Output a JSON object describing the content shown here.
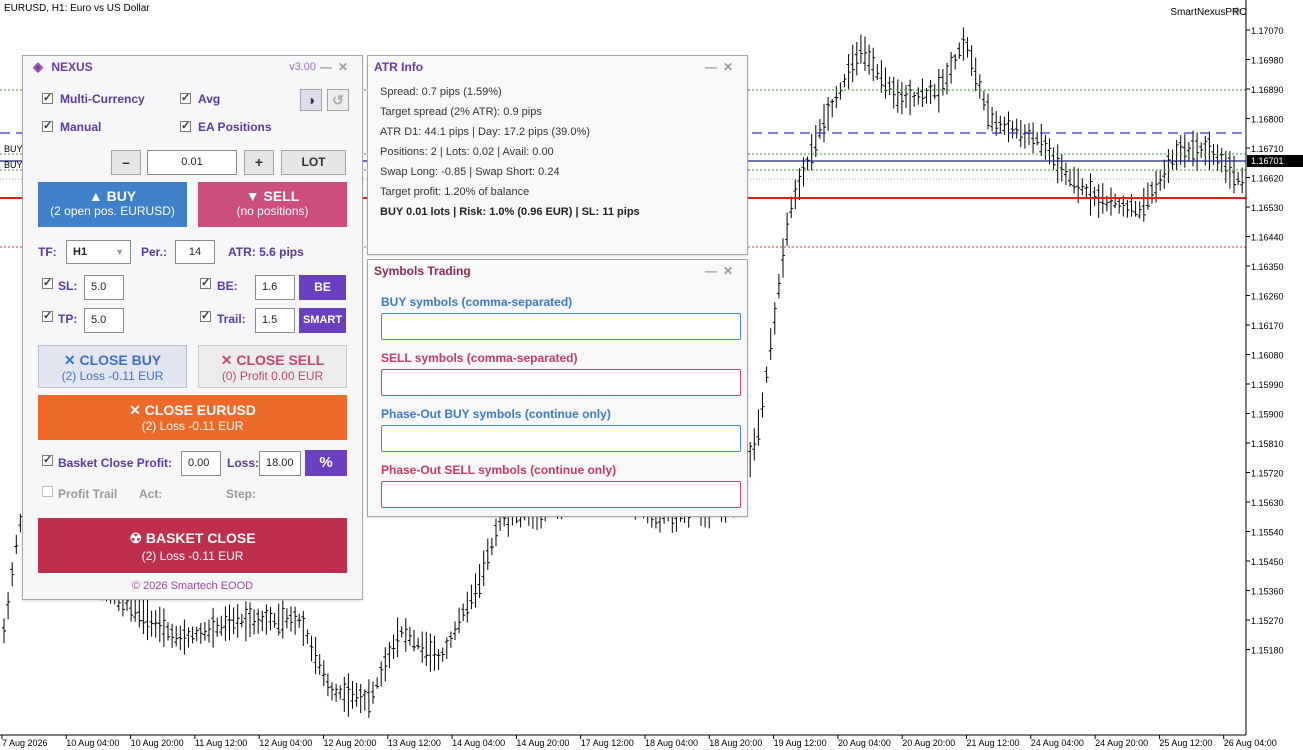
{
  "chart": {
    "title": "EURUSD, H1:  Euro vs US Dollar",
    "broker": "SmartNexusPRO",
    "price_labels": [
      "1.17070",
      "1.16980",
      "1.16890",
      "1.16800",
      "1.16710",
      "1.16620",
      "1.16530",
      "1.16440",
      "1.16350",
      "1.16260",
      "1.16170",
      "1.16080",
      "1.15990",
      "1.15900",
      "1.15810",
      "1.15720",
      "1.15630",
      "1.15540",
      "1.15450",
      "1.15360",
      "1.15270",
      "1.15180"
    ],
    "current_price": "1.16701",
    "time_labels": [
      "7 Aug 2026",
      "10 Aug 04:00",
      "10 Aug 20:00",
      "11 Aug 12:00",
      "12 Aug 04:00",
      "12 Aug 20:00",
      "13 Aug 12:00",
      "14 Aug 04:00",
      "14 Aug 20:00",
      "17 Aug 12:00",
      "18 Aug 04:00",
      "18 Aug 20:00",
      "19 Aug 12:00",
      "20 Aug 04:00",
      "20 Aug 20:00",
      "21 Aug 12:00",
      "24 Aug 04:00",
      "24 Aug 20:00",
      "25 Aug 12:00",
      "26 Aug 04:00"
    ],
    "line_labels": [
      "BUY",
      "BUY"
    ],
    "colors": {
      "bid": "#1a237e",
      "sl": "#e02020",
      "be": "#2040d0",
      "tp": "#2a8a2a",
      "candle": "#000000"
    }
  },
  "nexus": {
    "title": "NEXUS",
    "version": "v3.00",
    "minimize": "—",
    "close": "✕",
    "opt_multi": "Multi-Currency",
    "opt_avg": "Avg",
    "opt_manual": "Manual",
    "opt_ea": "EA Positions",
    "theme_icon": "◑",
    "refresh_icon": "↺",
    "minus": "–",
    "lot_value": "0.01",
    "plus": "+",
    "lot_btn": "LOT",
    "buy_l1": "▲ BUY",
    "buy_l2": "(2 open pos. EURUSD)",
    "sell_l1": "▼ SELL",
    "sell_l2": "(no positions)",
    "tf_label": "TF:",
    "tf_value": "H1",
    "per_label": "Per.:",
    "per_value": "14",
    "atr_label": "ATR: 5.6 pips",
    "sl_label": "SL:",
    "sl_value": "5.0",
    "be_label": "BE:",
    "be_value": "1.6",
    "be_btn": "BE",
    "tp_label": "TP:",
    "tp_value": "5.0",
    "trail_label": "Trail:",
    "trail_value": "1.5",
    "smart_btn": "SMART",
    "close_buy_l1": "✕ CLOSE BUY",
    "close_buy_l2": "(2) Loss -0.11 EUR",
    "close_sell_l1": "✕ CLOSE SELL",
    "close_sell_l2": "(0) Profit 0.00 EUR",
    "close_sym_l1": "✕ CLOSE EURUSD",
    "close_sym_l2": "(2) Loss -0.11 EUR",
    "basket_profit_label": "Basket Close Profit:",
    "basket_profit_value": "0.00",
    "loss_label": "Loss:",
    "loss_value": "18.00",
    "percent_btn": "%",
    "profit_trail_label": "Profit Trail",
    "act_label": "Act:",
    "step_label": "Step:",
    "basket_l1": "☢ BASKET CLOSE",
    "basket_l2": "(2) Loss -0.11 EUR",
    "footer": "© 2026 Smartech EOOD"
  },
  "atr": {
    "title": "ATR Info",
    "minimize": "—",
    "close": "✕",
    "lines": [
      "Spread: 0.7 pips (1.59%)",
      "Target spread (2% ATR): 0.9 pips",
      "ATR D1: 44.1 pips | Day: 17.2 pips (39.0%)",
      "Positions: 2 | Lots: 0.02 | Avail: 0.00",
      "Swap Long: -0.85 | Swap Short: 0.24",
      "Target profit: 1.20% of balance",
      "BUY 0.01 lots | Risk: 1.0% (0.96 EUR) | SL: 11 pips"
    ]
  },
  "symbols": {
    "title": "Symbols Trading",
    "minimize": "—",
    "close": "✕",
    "buy_label": "BUY symbols (comma-separated)",
    "sell_label": "SELL symbols (comma-separated)",
    "po_buy_label": "Phase-Out BUY symbols (continue only)",
    "po_sell_label": "Phase-Out SELL symbols (continue only)",
    "buy_value": "",
    "sell_value": "",
    "po_buy_value": "",
    "po_sell_value": ""
  }
}
